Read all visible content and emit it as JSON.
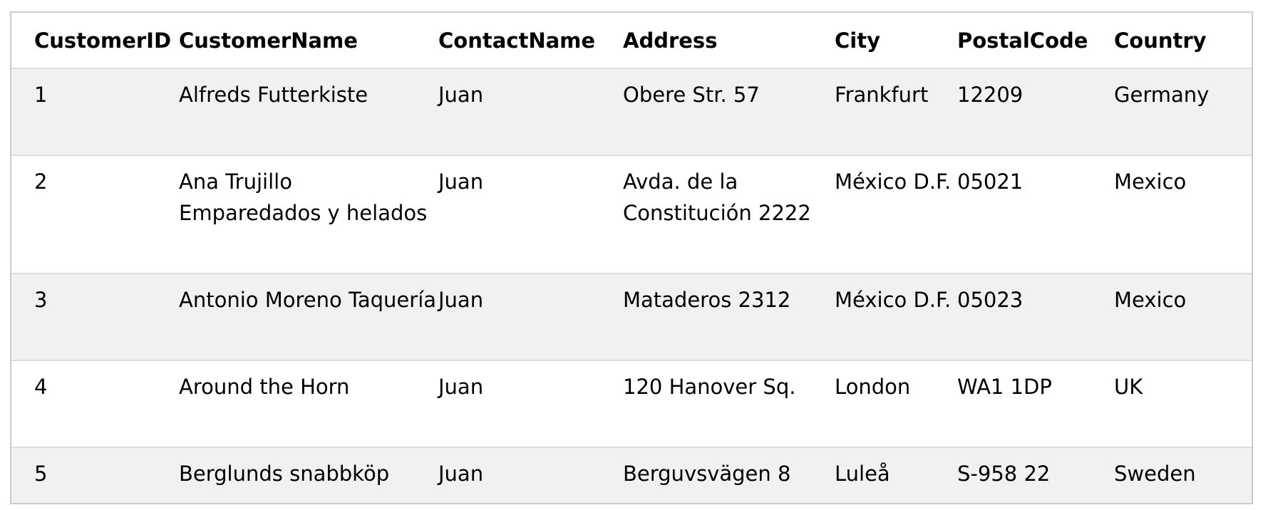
{
  "table": {
    "columns": [
      "CustomerID",
      "CustomerName",
      "ContactName",
      "Address",
      "City",
      "PostalCode",
      "Country"
    ],
    "rows": [
      {
        "id": "1",
        "name": "Alfreds Futterkiste",
        "contact": "Juan",
        "address": "Obere Str. 57",
        "city": "Frankfurt",
        "postal": "12209",
        "country": "Germany"
      },
      {
        "id": "2",
        "name": "Ana Trujillo Emparedados y helados",
        "contact": "Juan",
        "address": "Avda. de la Constitución 2222",
        "city": "México D.F.",
        "postal": "05021",
        "country": "Mexico"
      },
      {
        "id": "3",
        "name": "Antonio Moreno Taquería",
        "contact": "Juan",
        "address": "Mataderos 2312",
        "city": "México D.F.",
        "postal": "05023",
        "country": "Mexico"
      },
      {
        "id": "4",
        "name": "Around the Horn",
        "contact": "Juan",
        "address": "120 Hanover Sq.",
        "city": "London",
        "postal": "WA1 1DP",
        "country": "UK"
      },
      {
        "id": "5",
        "name": "Berglunds snabbköp",
        "contact": "Juan",
        "address": "Berguvsvägen 8",
        "city": "Luleå",
        "postal": "S-958 22",
        "country": "Sweden"
      }
    ]
  }
}
